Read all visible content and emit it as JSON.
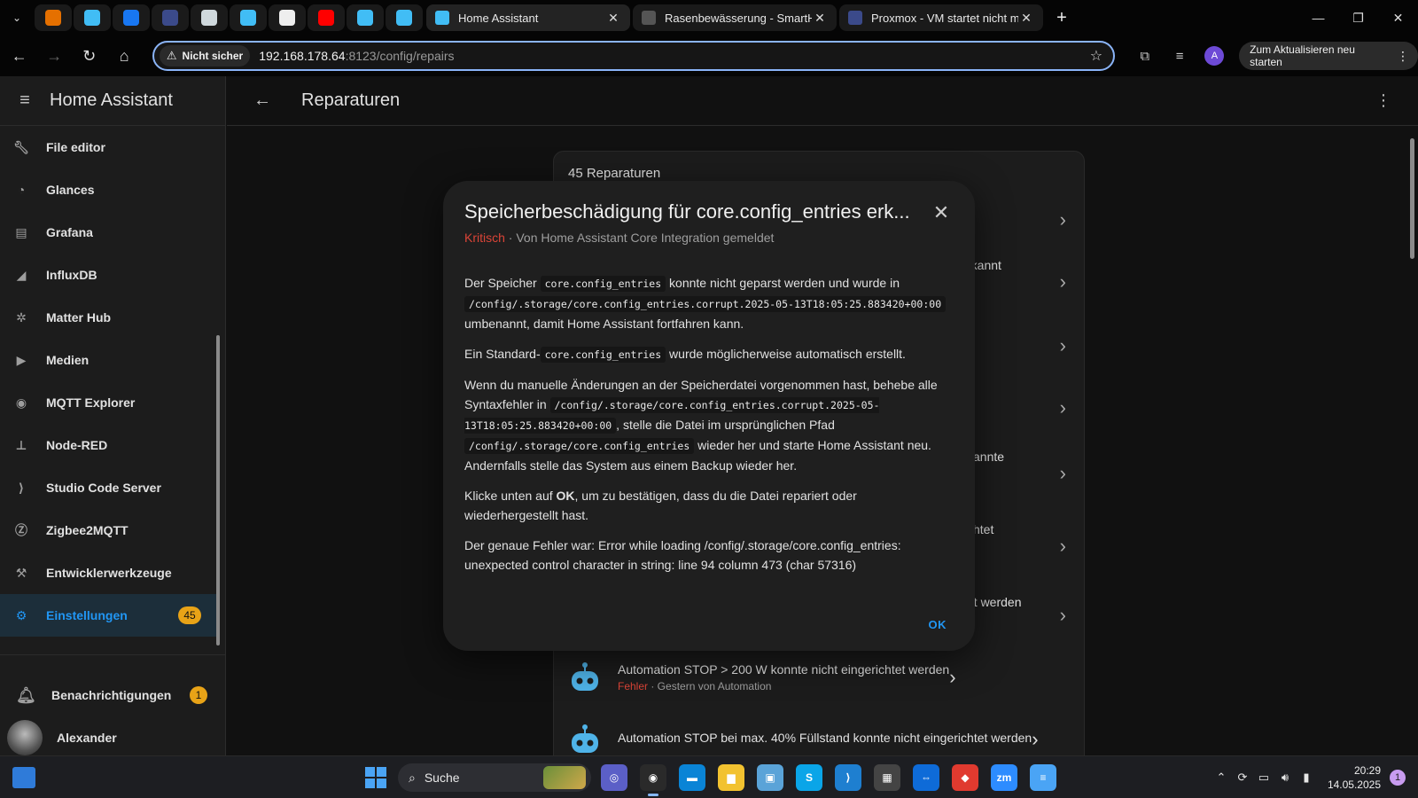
{
  "browser": {
    "tabs": [
      {
        "title": "Home Assistant",
        "favicon_color": "#41bdf5",
        "active": true
      },
      {
        "title": "Rasenbewässerung - SmartHom",
        "favicon_color": "#555555",
        "active": false
      },
      {
        "title": "Proxmox - VM startet nicht mel",
        "favicon_color": "#3b4a8a",
        "active": false
      }
    ],
    "pinned_tabs": [
      {
        "name": "proxmox-favicon",
        "color": "#e57000"
      },
      {
        "name": "home-assistant-favicon",
        "color": "#41bdf5"
      },
      {
        "name": "facebook-favicon",
        "color": "#1877f2"
      },
      {
        "name": "forum-favicon",
        "color": "#3b4a8a"
      },
      {
        "name": "grid-favicon",
        "color": "#cfd8dc"
      },
      {
        "name": "home-assistant-favicon",
        "color": "#41bdf5"
      },
      {
        "name": "openai-favicon",
        "color": "#eeeeee"
      },
      {
        "name": "youtube-favicon",
        "color": "#ff0000"
      },
      {
        "name": "home-assistant-favicon",
        "color": "#41bdf5"
      },
      {
        "name": "home-assistant-favicon",
        "color": "#41bdf5"
      }
    ],
    "security_label": "Nicht sicher",
    "url_host": "192.168.178.64",
    "url_rest": ":8123/config/repairs",
    "profile_initial": "A",
    "update_label": "Zum Aktualisieren neu starten"
  },
  "sidebar": {
    "title": "Home Assistant",
    "items": [
      {
        "label": "File editor",
        "icon": "wrench-icon"
      },
      {
        "label": "Glances",
        "icon": "gauge-icon"
      },
      {
        "label": "Grafana",
        "icon": "chart-icon"
      },
      {
        "label": "InfluxDB",
        "icon": "chart-area-icon"
      },
      {
        "label": "Matter Hub",
        "icon": "hub-icon"
      },
      {
        "label": "Medien",
        "icon": "media-icon"
      },
      {
        "label": "MQTT Explorer",
        "icon": "podcast-icon"
      },
      {
        "label": "Node-RED",
        "icon": "sitemap-icon"
      },
      {
        "label": "Studio Code Server",
        "icon": "vscode-icon"
      },
      {
        "label": "Zigbee2MQTT",
        "icon": "zigbee-icon"
      },
      {
        "label": "Entwicklerwerkzeuge",
        "icon": "hammer-icon"
      },
      {
        "label": "Einstellungen",
        "icon": "cog-icon",
        "badge": "45",
        "active": true
      }
    ],
    "notifications_label": "Benachrichtigungen",
    "notifications_badge": "1",
    "user_name": "Alexander"
  },
  "main": {
    "title": "Reparaturen",
    "count_label": "45 Reparaturen",
    "partial_rows": [
      {
        "text": ""
      },
      {
        "text": "rkannt"
      },
      {
        "text": ""
      },
      {
        "text": ""
      },
      {
        "text": "kannte"
      },
      {
        "text": "chtet"
      },
      {
        "text": "et werden"
      }
    ],
    "automation_rows": [
      {
        "title": "Automation STOP > 200 W konnte nicht eingerichtet werden",
        "severity": "Fehler",
        "meta": " · Gestern von Automation"
      },
      {
        "title": "Automation STOP bei max. 40% Füllstand konnte nicht eingerichtet werden",
        "severity": "",
        "meta": ""
      }
    ]
  },
  "dialog": {
    "title": "Speicherbeschädigung für core.config_entries erk...",
    "severity": "Kritisch",
    "reported_by": " · Von Home Assistant Core Integration gemeldet",
    "p1_a": "Der Speicher ",
    "p1_code1": "core.config_entries",
    "p1_b": " konnte nicht geparst werden und wurde in ",
    "p1_code2": "/config/.storage/core.config_entries.corrupt.2025-05-13T18:05:25.883420+00:00",
    "p1_c": " umbenannt, damit Home Assistant fortfahren kann.",
    "p2_a": "Ein Standard-",
    "p2_code": "core.config_entries",
    "p2_b": " wurde möglicherweise automatisch erstellt.",
    "p3_a": "Wenn du manuelle Änderungen an der Speicherdatei vorgenommen hast, behebe alle Syntaxfehler in ",
    "p3_code1": "/config/.storage/core.config_entries.corrupt.2025-05-13T18:05:25.883420+00:00",
    "p3_b": ", stelle die Datei im ursprünglichen Pfad ",
    "p3_code2": "/config/.storage/core.config_entries",
    "p3_c": " wieder her und starte Home Assistant neu. Andernfalls stelle das System aus einem Backup wieder her.",
    "p4_a": "Klicke unten auf ",
    "p4_b": "OK",
    "p4_c": ", um zu bestätigen, dass du die Datei repariert oder wiederhergestellt hast.",
    "p5": "Der genaue Fehler war: Error while loading /config/.storage/core.config_entries: unexpected control character in string: line 94 column 473 (char 57316)",
    "ok_label": "OK"
  },
  "taskbar": {
    "search_label": "Suche",
    "time": "20:29",
    "date": "14.05.2025",
    "notification_count": "1",
    "apps": [
      {
        "name": "teams-app-icon",
        "color": "#5b5fc7",
        "glyph": "◎"
      },
      {
        "name": "chrome-app-icon",
        "color": "#2a2a2a",
        "glyph": "◉",
        "active": true
      },
      {
        "name": "store-app-icon",
        "color": "#0a84d6",
        "glyph": "▬"
      },
      {
        "name": "explorer-app-icon",
        "color": "#f2c230",
        "glyph": "▆"
      },
      {
        "name": "photos-app-icon",
        "color": "#5aa3d8",
        "glyph": "▣"
      },
      {
        "name": "skype-app-icon",
        "color": "#0aa5e8",
        "glyph": "S"
      },
      {
        "name": "vscode-app-icon",
        "color": "#1e7fd0",
        "glyph": "⟩"
      },
      {
        "name": "calculator-app-icon",
        "color": "#444444",
        "glyph": "▦"
      },
      {
        "name": "teamviewer-app-icon",
        "color": "#0e6bd8",
        "glyph": "⇔"
      },
      {
        "name": "anydesk-app-icon",
        "color": "#e03a2f",
        "glyph": "◆"
      },
      {
        "name": "zoom-app-icon",
        "color": "#2d8cff",
        "glyph": "zm"
      },
      {
        "name": "notepad-app-icon",
        "color": "#4aa4f5",
        "glyph": "≡"
      }
    ]
  }
}
